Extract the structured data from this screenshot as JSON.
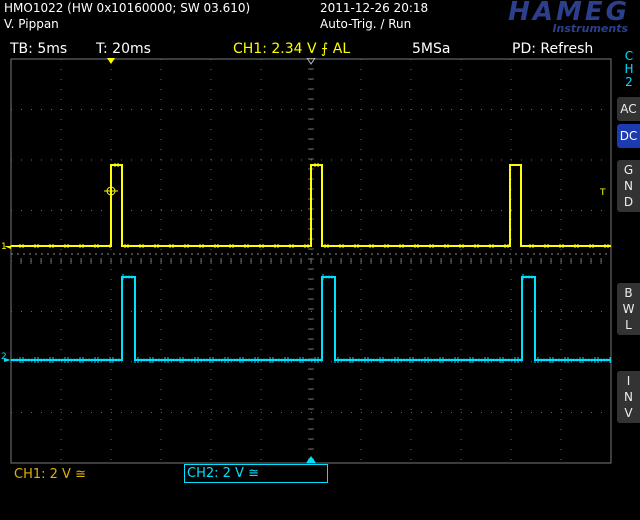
{
  "header": {
    "model": "HMO1022 (HW 0x10160000; SW 03.610)",
    "user": "V. Pippan",
    "datetime": "2011-12-26 20:18",
    "trigger_state": "Auto-Trig. / Run",
    "logo": "HAMEG",
    "logo_sub": "Instruments"
  },
  "status": {
    "timebase": "TB: 5ms",
    "trigger_time": "T: 20ms",
    "ch1_trigger": "CH1: 2.34 V ⨍ AL",
    "sample_rate": "5MSa",
    "pd": "PD: Refresh"
  },
  "side_menu": {
    "channel_tab": [
      "C",
      "H",
      "2"
    ],
    "buttons": [
      {
        "label": "AC",
        "active": false
      },
      {
        "label": "DC",
        "active": true
      },
      {
        "label": "G N D",
        "active": false
      },
      {
        "label": "B W L",
        "active": false
      },
      {
        "label": "I N V",
        "active": false
      }
    ]
  },
  "bottom": {
    "ch1": "CH1: 2 V ≅",
    "ch2": "CH2: 2 V ≅"
  },
  "markers": {
    "ch1_label": "1",
    "ch2_label": "2",
    "trigger_level": "T"
  },
  "colors": {
    "ch1": "#ffff00",
    "ch2": "#00e0ff",
    "grid": "#6a6a6a",
    "active_button": "#1c3bb0",
    "logo": "#2c3f8c"
  }
}
